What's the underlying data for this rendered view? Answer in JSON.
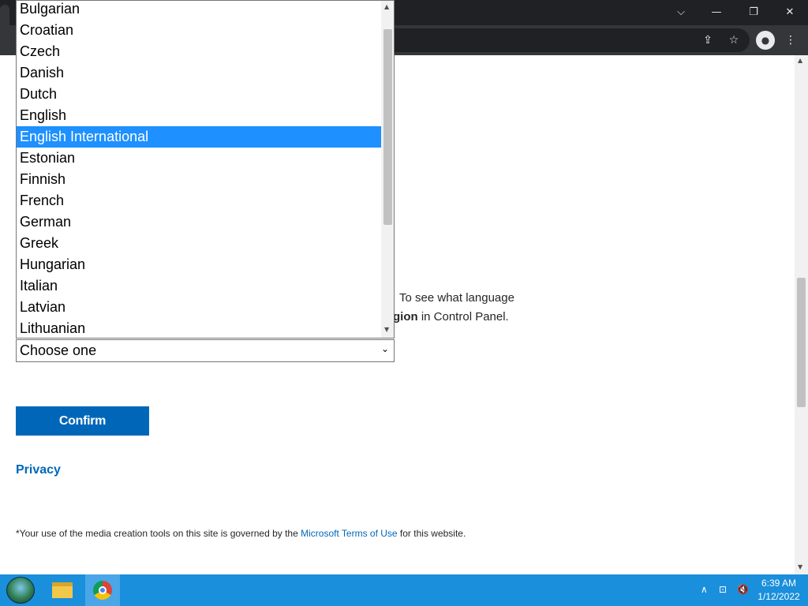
{
  "browser": {
    "window_controls": {
      "tab_search": "⌵",
      "minimize": "—",
      "restore": "❐",
      "close": "✕"
    },
    "toolbar_icons": [
      "share-icon",
      "star-icon",
      "profile-icon",
      "menu-icon"
    ]
  },
  "page": {
    "description_line1_suffix": "To see what language",
    "description_line2_bold": "gion",
    "description_line2_rest": " in Control Panel.",
    "language_select": {
      "selected_value": "Choose one"
    },
    "confirm_label": "Confirm",
    "privacy_label": "Privacy",
    "terms": {
      "prefix": "*Your use of the media creation tools on this site is governed by the ",
      "link": "Microsoft Terms of Use",
      "suffix": " for this website."
    }
  },
  "dropdown": {
    "options": [
      "Bulgarian",
      "Croatian",
      "Czech",
      "Danish",
      "Dutch",
      "English",
      "English International",
      "Estonian",
      "Finnish",
      "French",
      "German",
      "Greek",
      "Hungarian",
      "Italian",
      "Latvian",
      "Lithuanian"
    ],
    "highlighted": "English International"
  },
  "taskbar": {
    "time": "6:39 AM",
    "date": "1/12/2022",
    "tray_up": "∧",
    "network": "⊡",
    "volume": "🔇"
  },
  "colors": {
    "accent": "#0067b8",
    "highlight": "#1e90ff",
    "taskbar": "#1a8fdc"
  }
}
